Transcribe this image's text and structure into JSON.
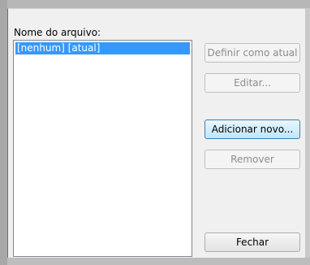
{
  "file_list": {
    "label": "Nome do arquivo:",
    "items": [
      {
        "text": "[nenhum] [atual]",
        "selected": true
      }
    ]
  },
  "buttons": {
    "set_current": "Definir como atual",
    "edit": "Editar...",
    "add_new": "Adicionar novo...",
    "remove": "Remover",
    "close": "Fechar"
  },
  "colors": {
    "selection": "#3399ff",
    "dialog_bg": "#f0f0f0",
    "disabled_text": "#8d8d8d"
  }
}
